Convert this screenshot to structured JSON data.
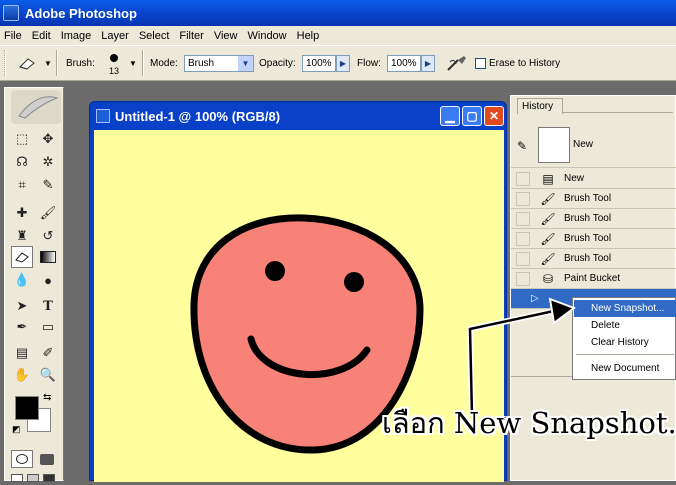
{
  "app": {
    "title": "Adobe Photoshop"
  },
  "menus": [
    "File",
    "Edit",
    "Image",
    "Layer",
    "Select",
    "Filter",
    "View",
    "Window",
    "Help"
  ],
  "options": {
    "brush_label": "Brush:",
    "brush_size": "13",
    "mode_label": "Mode:",
    "mode_value": "Brush",
    "opacity_label": "Opacity:",
    "opacity_value": "100%",
    "flow_label": "Flow:",
    "flow_value": "100%",
    "erase_to_history_label": "Erase to History"
  },
  "document": {
    "title": "Untitled-1 @ 100% (RGB/8)"
  },
  "colors": {
    "canvas": "#ffff9e",
    "face": "#f88178",
    "titlebar": "#0841c8",
    "highlight": "#316ac5"
  },
  "history": {
    "tab_label": "History",
    "snapshot_label": "New",
    "items": [
      {
        "label": "New",
        "icon": "document-icon"
      },
      {
        "label": "Brush Tool",
        "icon": "brush-icon"
      },
      {
        "label": "Brush Tool",
        "icon": "brush-icon"
      },
      {
        "label": "Brush Tool",
        "icon": "brush-icon"
      },
      {
        "label": "Brush Tool",
        "icon": "brush-icon"
      },
      {
        "label": "Paint Bucket",
        "icon": "paint-bucket-icon"
      }
    ]
  },
  "context_menu": {
    "items": [
      "New Snapshot...",
      "Delete",
      "Clear History",
      "New Document"
    ],
    "highlighted": "New Snapshot..."
  },
  "annotation": {
    "caption": "เลือก New Snapshot..."
  }
}
